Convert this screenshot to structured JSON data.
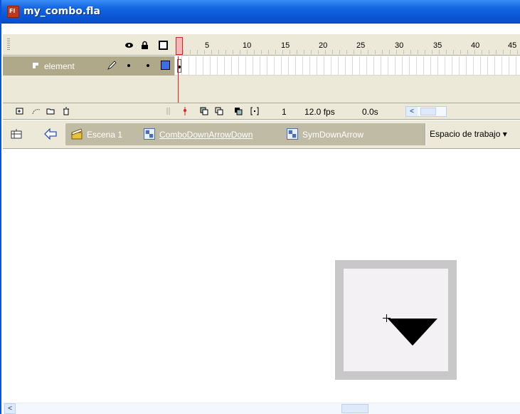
{
  "window": {
    "title": "my_combo.fla",
    "app_icon_text": "Fl"
  },
  "timeline": {
    "frame_numbers": [
      "5",
      "10",
      "15",
      "20",
      "25",
      "30",
      "35",
      "40",
      "45"
    ],
    "layer": {
      "name": "element"
    },
    "footer": {
      "frame": "1",
      "fps": "12.0 fps",
      "time": "0.0s"
    }
  },
  "editbar": {
    "breadcrumbs": [
      {
        "label": "Escena 1",
        "icon": "scene-icon"
      },
      {
        "label": "ComboDownArrowDown",
        "icon": "symbol-icon"
      },
      {
        "label": "SymDownArrow",
        "icon": "symbol-icon"
      }
    ],
    "workspace": "Espacio de trabajo ▾"
  },
  "colors": {
    "titlebar": "#0a52d6",
    "layer_row": "#b0a989",
    "playhead": "#e02020",
    "stage_frame": "#c8c8c8"
  }
}
